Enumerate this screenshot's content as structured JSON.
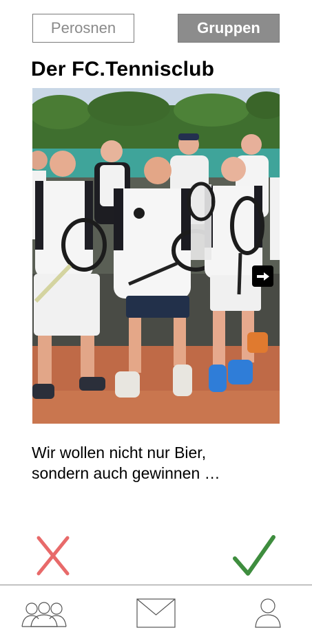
{
  "tabs": {
    "personen_label": "Perosnen",
    "gruppen_label": "Gruppen"
  },
  "group": {
    "title": "Der FC.Tennisclub",
    "description_line1": "Wir wollen nicht nur Bier,",
    "description_line2": "sondern auch gewinnen …"
  },
  "icons": {
    "next_photo": "arrow-right-icon",
    "reject": "close-icon",
    "accept": "checkmark-icon",
    "nav_groups": "group-icon",
    "nav_messages": "mail-icon",
    "nav_profile": "user-icon"
  },
  "colors": {
    "reject": "#e86a6a",
    "accept": "#3e8d3e",
    "active_tab": "#8c8c8c"
  }
}
